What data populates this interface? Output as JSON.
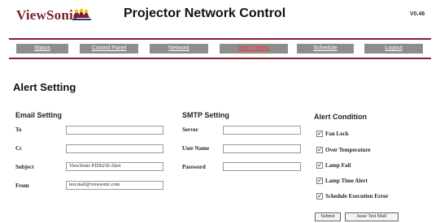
{
  "header": {
    "logo_text": "ViewSonic",
    "title": "Projector Network Control",
    "version": "V0.46"
  },
  "nav": {
    "items": [
      {
        "label": "Status",
        "active": false
      },
      {
        "label": "Control Panel",
        "active": false
      },
      {
        "label": "Network",
        "active": false
      },
      {
        "label": "Alert Setting",
        "active": true
      },
      {
        "label": "Schedule",
        "active": false
      },
      {
        "label": "Logout",
        "active": false
      }
    ]
  },
  "page_title": "Alert Setting",
  "email": {
    "heading": "Email Setting",
    "fields": [
      {
        "label": "To",
        "value": ""
      },
      {
        "label": "Cc",
        "value": ""
      },
      {
        "label": "Subject",
        "value": "ViewSonic PJD6230 Alert"
      },
      {
        "label": "From",
        "value": "test.mail@viewsonic.com"
      }
    ]
  },
  "smtp": {
    "heading": "SMTP Setting",
    "fields": [
      {
        "label": "Server",
        "value": ""
      },
      {
        "label": "User Name",
        "value": ""
      },
      {
        "label": "Password",
        "value": ""
      }
    ]
  },
  "alert": {
    "heading": "Alert Condition",
    "conditions": [
      {
        "label": "Fan Lock",
        "checked": true
      },
      {
        "label": "Over Temperature",
        "checked": true
      },
      {
        "label": "Lamp Fail",
        "checked": true
      },
      {
        "label": "Lamp Time Alert",
        "checked": true
      },
      {
        "label": "Schedule Execution Error",
        "checked": true
      }
    ],
    "buttons": {
      "submit": "Submit",
      "test": "Issue Test Mail"
    }
  },
  "colors": {
    "brand": "#8a1c2c",
    "tab_bg": "#8d8d8d",
    "active_tab_text": "#ff3333",
    "check": "#1f9a1f"
  }
}
